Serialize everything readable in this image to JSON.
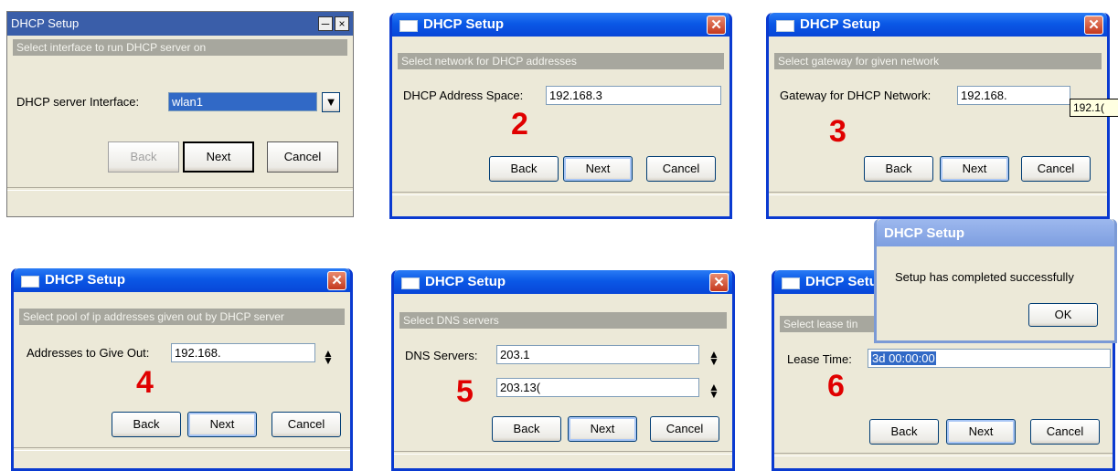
{
  "dialog_title": "DHCP Setup",
  "buttons": {
    "back": "Back",
    "next": "Next",
    "cancel": "Cancel",
    "ok": "OK"
  },
  "step1": {
    "title": "DHCP Setup",
    "instruction": "Select interface to run DHCP server on",
    "label": "DHCP server Interface:",
    "value": "wlan1",
    "min_icon": "minimize-icon",
    "close_icon": "close-icon"
  },
  "step2": {
    "number": "2",
    "instruction": "Select network for DHCP addresses",
    "label": "DHCP Address Space:",
    "value": "192.168.3"
  },
  "step3": {
    "number": "3",
    "instruction": "Select gateway for given network",
    "label": "Gateway for DHCP Network:",
    "value": "192.168.",
    "tooltip": "192.1("
  },
  "step4": {
    "number": "4",
    "instruction": "Select pool of ip addresses given out by DHCP server",
    "label": "Addresses to Give Out:",
    "value": "192.168."
  },
  "step5": {
    "number": "5",
    "instruction": "Select DNS servers",
    "label": "DNS Servers:",
    "dns1": "203.1",
    "dns2": "203.13("
  },
  "step6": {
    "number": "6",
    "instruction": "Select lease tin",
    "label": "Lease Time:",
    "value": "3d 00:00:00"
  },
  "completion": {
    "title": "DHCP Setup",
    "message": "Setup has completed successfully"
  },
  "colors": {
    "xp_blue": "#0a3ad0",
    "step_number": "#e00000",
    "instruction_band": "#a7a79e"
  }
}
